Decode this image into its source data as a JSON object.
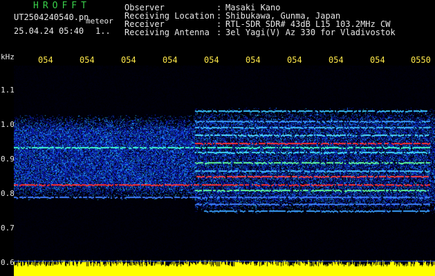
{
  "header": {
    "app_title": "HROFFT",
    "filename": "UT2504240540.pn",
    "tag": "meteor",
    "datetime": "25.04.24 05:40",
    "status": "1.."
  },
  "metadata": {
    "rows": [
      {
        "label": "Observer",
        "value": "Masaki Kano"
      },
      {
        "label": "Receiving Location",
        "value": "Shibukawa, Gunma, Japan"
      },
      {
        "label": "Receiver",
        "value": "RTL-SDR SDR# 43dB L15 103.2MHz CW"
      },
      {
        "label": "Receiving Antenna",
        "value": "3el Yagi(V) Az 330 for Vladivostok"
      }
    ],
    "separator": ":"
  },
  "axes": {
    "freq_unit": "kHz",
    "time_ticks": [
      "054",
      "054",
      "054",
      "054",
      "054",
      "054",
      "054",
      "054",
      "054",
      "0550"
    ],
    "freq_ticks": [
      "1.1",
      "1.0",
      "0.9",
      "0.8",
      "0.7",
      "0.6"
    ]
  },
  "colors": {
    "title": "#39d04a",
    "text": "#e8e8e8",
    "ticks": "#ffe84a",
    "background": "#000000",
    "noise_floor": "#1530c8",
    "band_yellow": "#ffff00",
    "signal_red": "#ff2020"
  }
}
